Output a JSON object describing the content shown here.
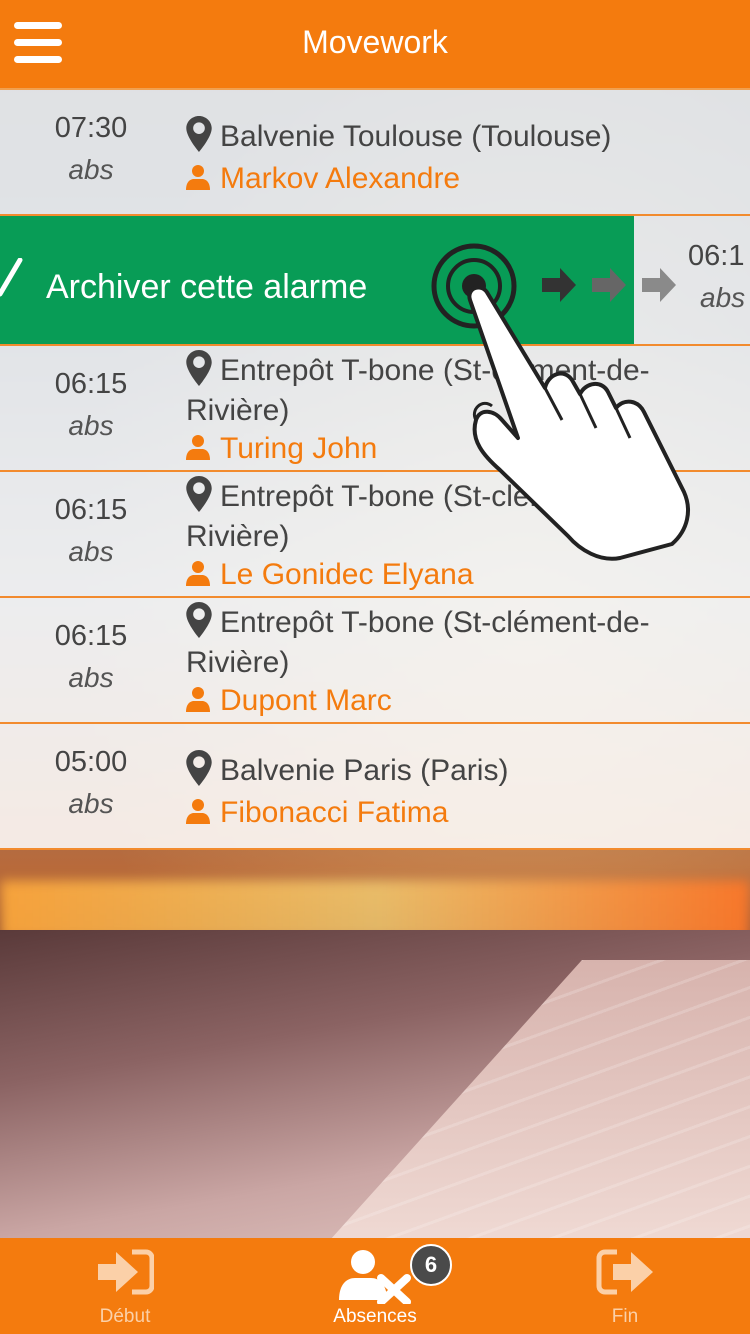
{
  "colors": {
    "accent": "#f47b0e",
    "archive": "#089c56",
    "text": "#444444"
  },
  "header": {
    "title": "Movework",
    "menu_icon": "hamburger-icon"
  },
  "rows": [
    {
      "time": "07:30",
      "status": "abs",
      "location": "Balvenie Toulouse (Toulouse)",
      "person": "Markov Alexandre"
    },
    {
      "time": "06:15",
      "status": "abs",
      "location": "Entrepôt T-bone (St-clément-de-Rivière)",
      "person": "Turing John"
    },
    {
      "time": "06:15",
      "status": "abs",
      "location": "Entrepôt T-bone (St-clément-de-Rivière)",
      "person": "Le Gonidec Elyana"
    },
    {
      "time": "06:15",
      "status": "abs",
      "location": "Entrepôt T-bone (St-clément-de-Rivière)",
      "person": "Dupont Marc"
    },
    {
      "time": "05:00",
      "status": "abs",
      "location": "Balvenie Paris (Paris)",
      "person": "Fibonacci Fatima"
    }
  ],
  "swipe": {
    "action_label": "Archiver cette alarme",
    "peek_time": "06:1",
    "peek_status": "abs",
    "check_icon": "check-icon",
    "gesture_icon": "swipe-hand-icon"
  },
  "tabs": [
    {
      "label": "Début",
      "icon": "sign-in-icon",
      "active": false
    },
    {
      "label": "Absences",
      "icon": "user-times-icon",
      "active": true,
      "badge": "6"
    },
    {
      "label": "Fin",
      "icon": "sign-out-icon",
      "active": false
    }
  ]
}
